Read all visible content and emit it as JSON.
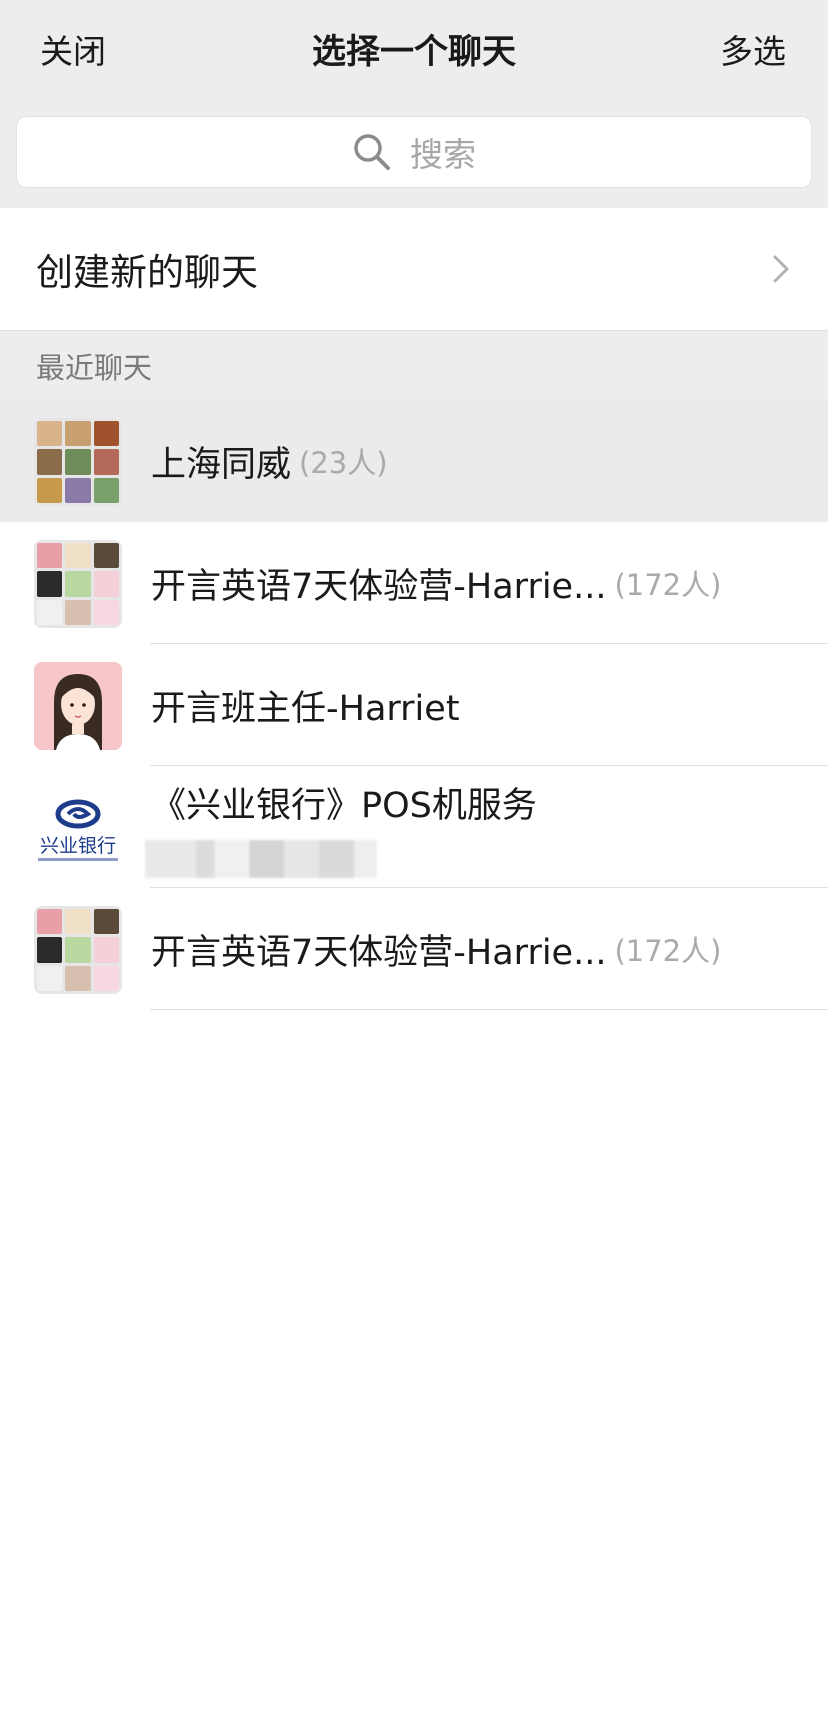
{
  "nav": {
    "close_label": "关闭",
    "title": "选择一个聊天",
    "multi_select_label": "多选"
  },
  "search": {
    "placeholder": "搜索",
    "icon": "search-icon"
  },
  "new_chat": {
    "label": "创建新的聊天",
    "icon": "chevron-right-icon"
  },
  "recent": {
    "header": "最近聊天",
    "items": [
      {
        "name": "上海同威",
        "count": "(23人)",
        "selected": true
      },
      {
        "name": "开言英语7天体验营-Harrie...",
        "count": "(172人)",
        "selected": false
      },
      {
        "name": "开言班主任-Harriet",
        "count": "",
        "selected": false
      },
      {
        "name": "《兴业银行》POS机服务",
        "count": "",
        "selected": false
      },
      {
        "name": "开言英语7天体验营-Harrie...",
        "count": "(172人)",
        "selected": false
      }
    ]
  },
  "colors": {
    "header_bg": "#ededed",
    "row_selected_bg": "#ebebeb",
    "count_text": "#aaaaaa",
    "bank_logo_blue": "#1e3c8c"
  },
  "avatar_logo_text": "兴业银行"
}
